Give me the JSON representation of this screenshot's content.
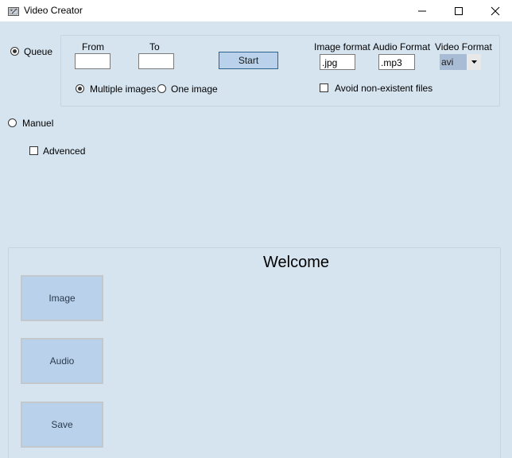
{
  "window": {
    "title": "Video Creator",
    "icons": [
      "app-icon",
      "minimize-icon",
      "maximize-icon",
      "close-icon"
    ]
  },
  "mode": {
    "queue_label": "Queue",
    "queue_selected": true,
    "manuel_label": "Manuel",
    "manuel_selected": false
  },
  "queue": {
    "from_label": "From",
    "from_value": "",
    "to_label": "To",
    "to_value": "",
    "start_label": "Start",
    "multiple_images_label": "Multiple images",
    "multiple_images_selected": true,
    "one_image_label": "One image",
    "one_image_selected": false,
    "image_format_label": "Image format",
    "image_format_value": ".jpg",
    "audio_format_label": "Audio Format",
    "audio_format_value": ".mp3",
    "video_format_label": "Video Format",
    "video_format_value": "avi",
    "avoid_label": "Avoid non-existent files",
    "avoid_checked": false
  },
  "advanced": {
    "label": "Advenced",
    "checked": false
  },
  "main": {
    "welcome": "Welcome",
    "image_button": "Image",
    "audio_button": "Audio",
    "save_button": "Save"
  },
  "colors": {
    "background": "#d6e4f0",
    "button_fill": "#b9d1ea",
    "start_border": "#2c628b",
    "select_highlight": "#a9bcd6"
  }
}
